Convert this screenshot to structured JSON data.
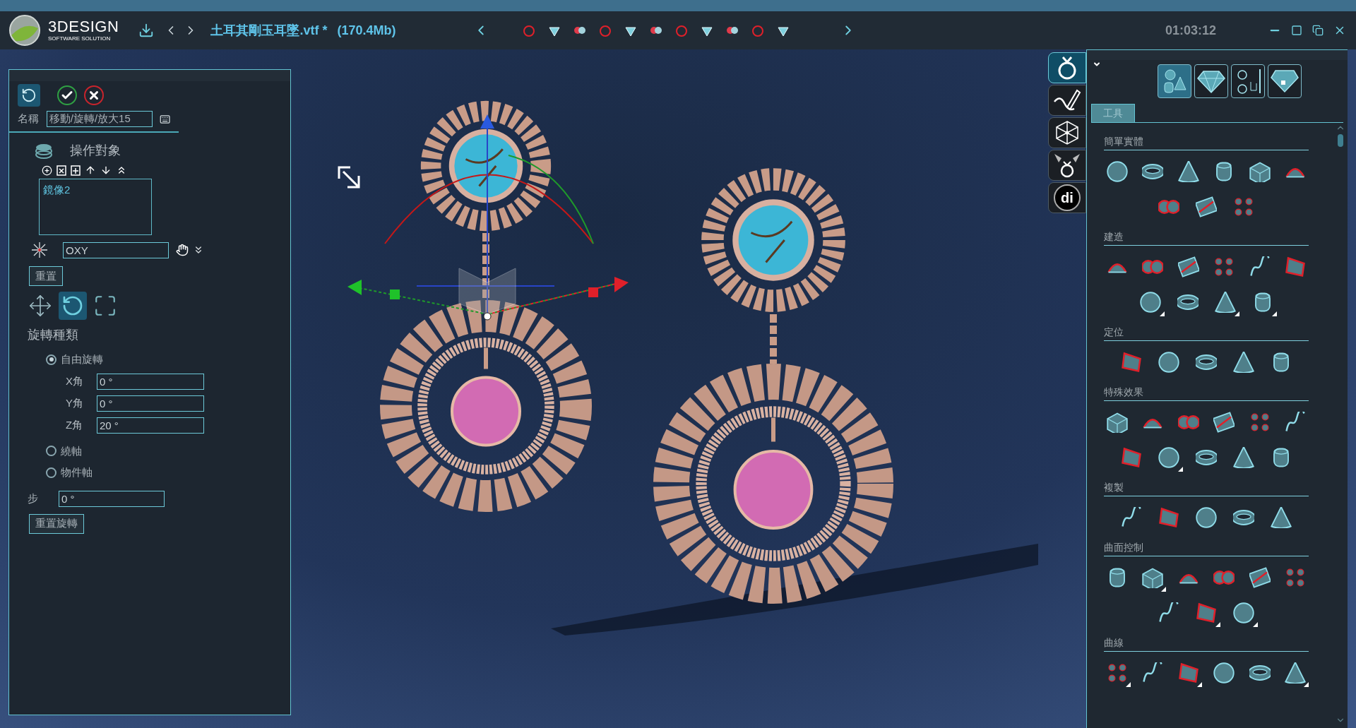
{
  "app": {
    "logo_name": "3DESIGN",
    "logo_tagline": "SOFTWARE SOLUTION",
    "file_name": "土耳其剛玉耳墜.vtf *",
    "file_size": "(170.4Mb)",
    "clock": "01:03:12"
  },
  "toolbar": {
    "tools": [
      {
        "selected": false
      },
      {
        "selected": false
      },
      {
        "selected": false
      },
      {
        "selected": false
      },
      {
        "selected": false
      },
      {
        "selected": false
      },
      {
        "selected": false
      },
      {
        "selected": false
      },
      {
        "selected": false
      },
      {
        "selected": false
      },
      {
        "selected": false
      }
    ]
  },
  "operation_panel": {
    "name_label": "名稱",
    "name_value": "移動/旋轉/放大15",
    "targets_title": "操作對象",
    "targets": [
      {
        "label": "鏡像2",
        "selected": false
      }
    ],
    "plane_value": "OXY",
    "reset_button": "重置",
    "modes": [
      {
        "kind": "move",
        "selected": false
      },
      {
        "kind": "rotate",
        "selected": true
      },
      {
        "kind": "scale",
        "selected": false
      }
    ],
    "rotation_type_title": "旋轉種類",
    "rotation_types": [
      {
        "label": "自由旋轉",
        "selected": true
      },
      {
        "label": "繞軸",
        "selected": false
      },
      {
        "label": "物件軸",
        "selected": false
      }
    ],
    "angles": [
      {
        "label": "X角",
        "value": "0 °"
      },
      {
        "label": "Y角",
        "value": "0 °"
      },
      {
        "label": "Z角",
        "value": "20 °"
      }
    ],
    "step_label": "步",
    "step_value": "0 °",
    "reset_rotation_button": "重置旋轉"
  },
  "side_tabs": [
    {
      "kind": "ring",
      "selected": true
    },
    {
      "kind": "sketch",
      "selected": false
    },
    {
      "kind": "mesh",
      "selected": false
    },
    {
      "kind": "render",
      "selected": false
    },
    {
      "kind": "logo",
      "selected": false,
      "label": "di"
    }
  ],
  "tool_panel": {
    "categories": [
      {
        "kind": "primitives",
        "selected": true
      },
      {
        "kind": "gems",
        "selected": false
      },
      {
        "kind": "rings",
        "selected": false
      },
      {
        "kind": "puzzle",
        "selected": false
      }
    ],
    "tabs": [
      {
        "label": "工具",
        "selected": true
      }
    ],
    "sections": [
      {
        "title": "簡單實體",
        "rows": [
          [
            {
              "submenu": false
            },
            {
              "submenu": false
            },
            {
              "submenu": false
            },
            {
              "submenu": false
            },
            {
              "submenu": false
            },
            {
              "submenu": false
            }
          ],
          [
            {
              "submenu": false
            },
            {
              "submenu": false
            },
            {
              "submenu": false
            }
          ]
        ]
      },
      {
        "title": "建造",
        "rows": [
          [
            {
              "submenu": false
            },
            {
              "submenu": false
            },
            {
              "submenu": false
            },
            {
              "submenu": false
            },
            {
              "submenu": false
            },
            {
              "submenu": false
            }
          ],
          [
            {
              "submenu": true
            },
            {
              "submenu": false
            },
            {
              "submenu": true
            },
            {
              "submenu": true
            }
          ]
        ]
      },
      {
        "title": "定位",
        "rows": [
          [
            {
              "submenu": false
            },
            {
              "submenu": false
            },
            {
              "submenu": false
            },
            {
              "submenu": false
            },
            {
              "submenu": false
            }
          ]
        ]
      },
      {
        "title": "特殊效果",
        "rows": [
          [
            {
              "submenu": false
            },
            {
              "submenu": false
            },
            {
              "submenu": false
            },
            {
              "submenu": false
            },
            {
              "submenu": false
            },
            {
              "submenu": false
            }
          ],
          [
            {
              "submenu": false
            },
            {
              "submenu": true
            },
            {
              "submenu": false
            },
            {
              "submenu": false
            },
            {
              "submenu": false
            }
          ]
        ]
      },
      {
        "title": "複製",
        "rows": [
          [
            {
              "submenu": false
            },
            {
              "submenu": false
            },
            {
              "submenu": false
            },
            {
              "submenu": false
            },
            {
              "submenu": false
            }
          ]
        ]
      },
      {
        "title": "曲面控制",
        "rows": [
          [
            {
              "submenu": false
            },
            {
              "submenu": true
            },
            {
              "submenu": false
            },
            {
              "submenu": false
            },
            {
              "submenu": false
            },
            {
              "submenu": false
            }
          ],
          [
            {
              "submenu": false
            },
            {
              "submenu": true
            },
            {
              "submenu": true
            }
          ]
        ]
      },
      {
        "title": "曲線",
        "rows": [
          [
            {
              "submenu": true
            },
            {
              "submenu": false
            },
            {
              "submenu": true
            },
            {
              "submenu": false
            },
            {
              "submenu": false
            },
            {
              "submenu": true
            }
          ]
        ]
      }
    ]
  }
}
